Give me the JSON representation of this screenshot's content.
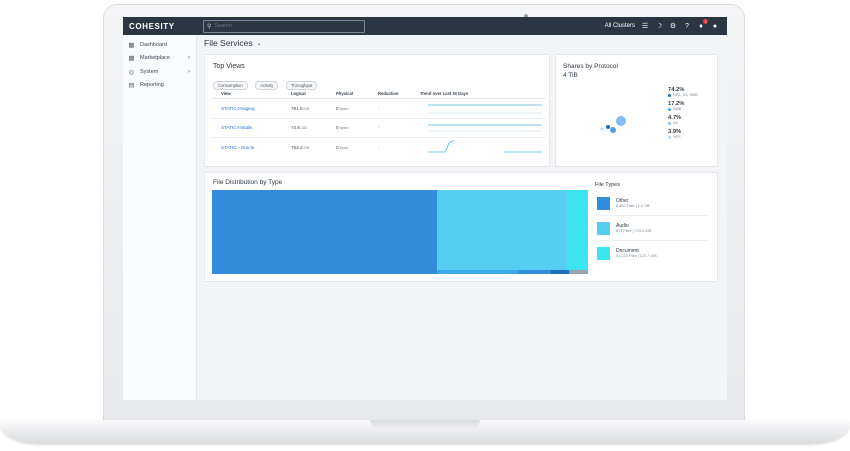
{
  "app": {
    "logo": "COHESITY"
  },
  "topbar": {
    "search_placeholder": "Search",
    "cluster_selector": "All Clusters",
    "notification_count": "1"
  },
  "sidebar": {
    "items": [
      {
        "label": "Dashboard",
        "icon": "dashboard-icon",
        "has_chevron": false
      },
      {
        "label": "Marketplace",
        "icon": "marketplace-icon",
        "has_chevron": true
      },
      {
        "label": "System",
        "icon": "globe-icon",
        "has_chevron": true
      },
      {
        "label": "Reporting",
        "icon": "report-icon",
        "has_chevron": false
      }
    ]
  },
  "page": {
    "title": "File Services"
  },
  "top_views": {
    "title": "Top Views",
    "chips": [
      "Consumption",
      "Activity",
      "Throughput"
    ],
    "columns": [
      "View",
      "Logical",
      "Physical",
      "Reduction",
      "Trend over Last 30 Days"
    ],
    "rows": [
      {
        "view": "STATIC-Imaging",
        "logical": "781.5",
        "logical_unit": "GiB",
        "physical": "0",
        "physical_unit": "Bytes",
        "reduction": "-"
      },
      {
        "view": "STATIC-Installs",
        "logical": "74.6",
        "logical_unit": "GiB",
        "physical": "0",
        "physical_unit": "Bytes",
        "reduction": "-"
      },
      {
        "view": "STATIC - Oracle",
        "logical": "763.2",
        "logical_unit": "GiB",
        "physical": "0",
        "physical_unit": "Bytes",
        "reduction": "-"
      }
    ]
  },
  "shares_by_protocol": {
    "title": "Shares by Protocol",
    "total": "4 TiB",
    "legend": [
      {
        "pct": "74.2%",
        "label": "NFS, S3, SMB",
        "color": "#1b6fb5"
      },
      {
        "pct": "17.2%",
        "label": "SMB",
        "color": "#4e9de8"
      },
      {
        "pct": "4.7%",
        "label": "S3",
        "color": "#82bdf2"
      },
      {
        "pct": "3.9%",
        "label": "NFS",
        "color": "#b8daf7"
      }
    ]
  },
  "file_distribution": {
    "title": "File Distribution by Type",
    "legend_title": "File Types",
    "types": [
      {
        "name": "Other",
        "sub": "6,460 Files | 1.4 TiB",
        "color": "#2f8ddb"
      },
      {
        "name": "Audio",
        "sub": "873 Files | 703.4 GiB",
        "color": "#56cdf3"
      },
      {
        "name": "Document",
        "sub": "51,123 Files | 123.7 GiB",
        "color": "#3be4ef"
      }
    ]
  }
}
